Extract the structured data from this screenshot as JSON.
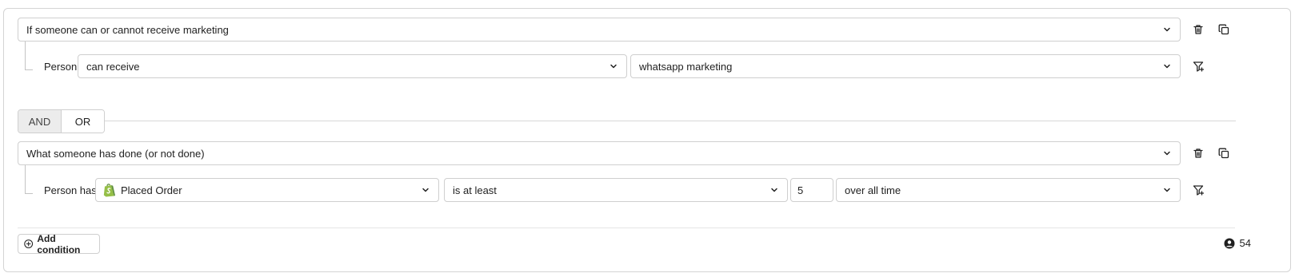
{
  "group1": {
    "condition_type": "If someone can or cannot receive marketing",
    "row": {
      "subject": "Person",
      "permission": "can receive",
      "channel": "whatsapp marketing"
    }
  },
  "logic": {
    "and_label": "AND",
    "or_label": "OR",
    "selected": "AND"
  },
  "group2": {
    "condition_type": "What someone has done (or not done)",
    "row": {
      "subject": "Person has",
      "metric": "Placed Order",
      "metric_icon": "shopify-icon",
      "operator": "is at least",
      "count": "5",
      "timeframe": "over all time"
    }
  },
  "footer": {
    "add_condition_label": "Add condition",
    "profile_count": "54"
  },
  "colors": {
    "border": "#cfcfcf",
    "shopify_green": "#95bf47",
    "active_segment": "#ececec"
  }
}
